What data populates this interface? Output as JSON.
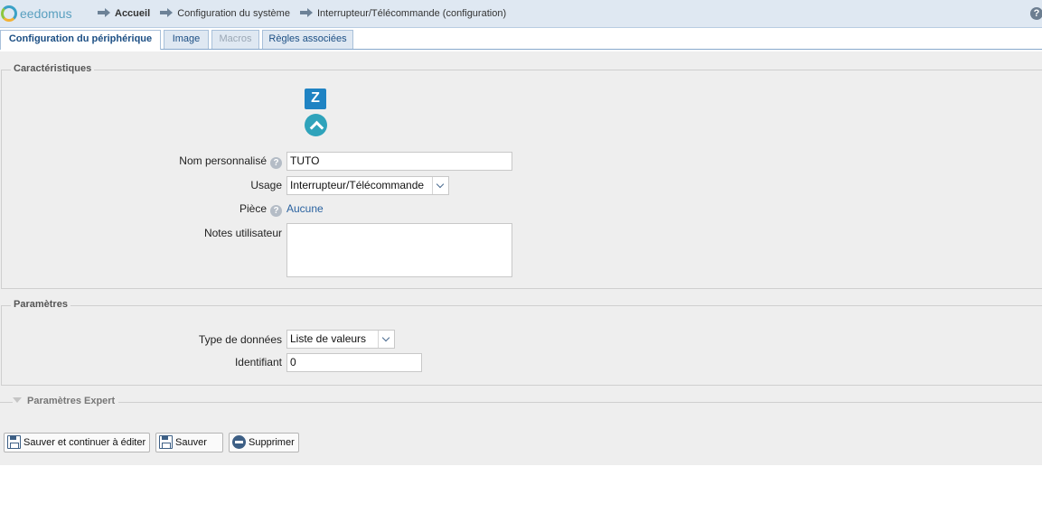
{
  "header": {
    "logo_text": "eedomus",
    "breadcrumbs": [
      "Accueil",
      "Configuration du système",
      "Interrupteur/Télécommande (configuration)"
    ],
    "help_glyph": "?"
  },
  "tabs": [
    {
      "label": "Configuration du périphérique",
      "state": "active"
    },
    {
      "label": "Image",
      "state": "normal"
    },
    {
      "label": "Macros",
      "state": "disabled"
    },
    {
      "label": "Règles associées",
      "state": "normal"
    }
  ],
  "characteristics": {
    "legend": "Caractéristiques",
    "zwave_icon_text": "Z",
    "name_label": "Nom personnalisé",
    "name_value": "TUTO",
    "usage_label": "Usage",
    "usage_value": "Interrupteur/Télécommande",
    "room_label": "Pièce",
    "room_value": "Aucune",
    "notes_label": "Notes utilisateur",
    "notes_value": ""
  },
  "parameters": {
    "legend": "Paramètres",
    "data_type_label": "Type de données",
    "data_type_value": "Liste de valeurs",
    "identifier_label": "Identifiant",
    "identifier_value": "0"
  },
  "expert": {
    "legend": "Paramètres Expert"
  },
  "buttons": {
    "save_continue": "Sauver et continuer à éditer",
    "save": "Sauver",
    "delete": "Supprimer"
  },
  "colors": {
    "header_bg": "#dfe8f2",
    "tab_text": "#1c4f84",
    "panel_bg": "#eeeeee",
    "link": "#2a62a0",
    "zwave_blue": "#1f83c3",
    "teal": "#2fa3bb"
  }
}
